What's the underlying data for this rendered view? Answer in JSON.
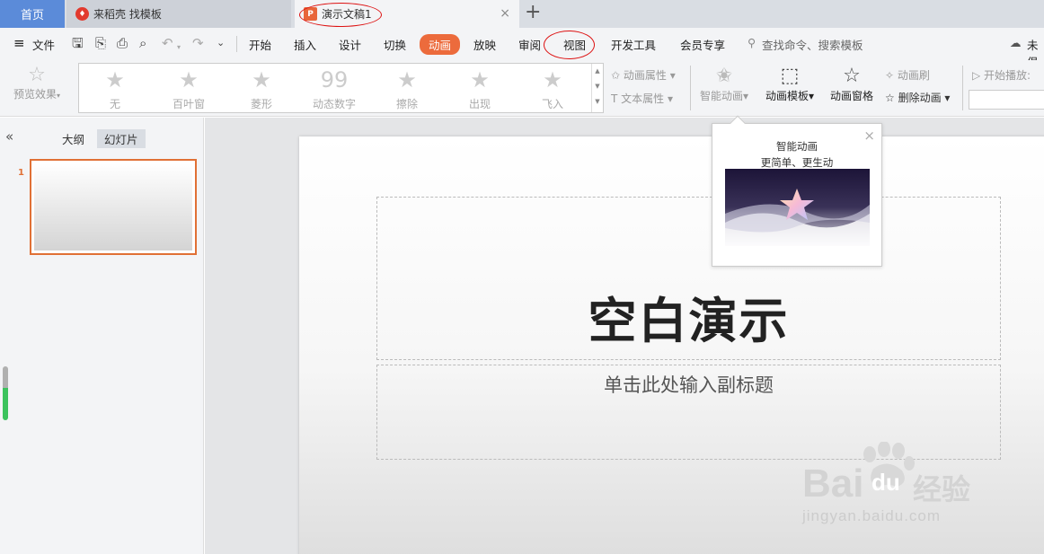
{
  "tabs": {
    "home": "首页",
    "tab1": "来稻壳 找模板",
    "tab2": "演示文稿1",
    "close": "×",
    "add": "+"
  },
  "menu": {
    "hamburger": "≡",
    "file": "文件",
    "items": [
      "开始",
      "插入",
      "设计",
      "切换",
      "动画",
      "放映",
      "审阅",
      "视图",
      "开发工具",
      "会员专享"
    ],
    "active_index": 4,
    "search": "查找命令、搜索模板",
    "cloud": "未俱"
  },
  "ribbon": {
    "preview": "预览效果",
    "gallery": [
      "无",
      "百叶窗",
      "菱形",
      "动态数字",
      "擦除",
      "出现",
      "飞入"
    ],
    "anim_props": "动画属性",
    "text_props": "文本属性",
    "smart_anim": "智能动画",
    "anim_template": "动画模板",
    "anim_pane": "动画窗格",
    "anim_brush": "动画刷",
    "delete_anim": "删除动画",
    "start_play": "开始播放:"
  },
  "left_panel": {
    "collapse": "«",
    "outline": "大纲",
    "slides": "幻灯片",
    "slide_number": "1"
  },
  "slide": {
    "title": "空白演示",
    "subtitle": "单击此处输入副标题"
  },
  "popup": {
    "line1": "智能动画",
    "line2": "更简单、更生动",
    "close": "×"
  },
  "watermark": {
    "brand": "Bai",
    "brand2": "du",
    "suffix": "经验",
    "url": "jingyan.baidu.com"
  },
  "colors": {
    "accent": "#ec6b3c",
    "home_tab": "#5b8bd9",
    "annotation": "#dd1111"
  }
}
